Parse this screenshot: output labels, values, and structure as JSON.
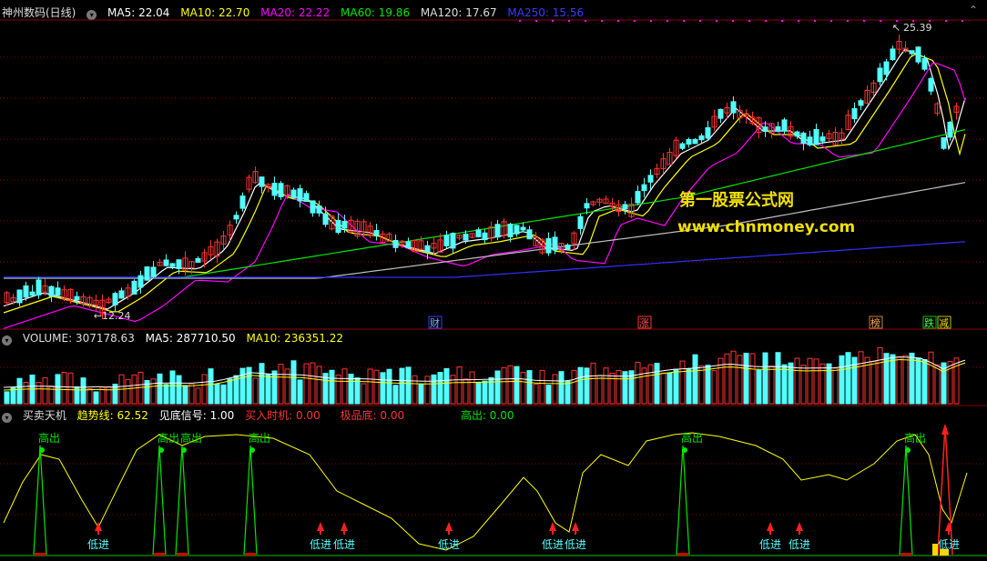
{
  "main_header": {
    "title": "神州数码(日线)",
    "ma5": "MA5: 22.04",
    "ma10": "MA10: 22.70",
    "ma20": "MA20: 22.22",
    "ma60": "MA60: 19.86",
    "ma120": "MA120: 17.67",
    "ma250": "MA250: 15.56"
  },
  "volume_header": {
    "title": "VOLUME: 307178.63",
    "ma5": "MA5: 287710.50",
    "ma10": "MA10: 236351.22"
  },
  "indicator_header": {
    "title": "买卖天机",
    "trend": "趋势线: 62.52",
    "bottom": "见底信号: 1.00",
    "buy": "买入时机: 0.00",
    "extreme": "极品底: 0.00",
    "high": "高出: 0.00"
  },
  "price_labels": {
    "high": "25.39",
    "low": "12.24"
  },
  "event_markers": [
    "财",
    "涨",
    "榜",
    "跌",
    "减"
  ],
  "signal_labels": {
    "high_out": "高出",
    "low_in": "低进"
  },
  "watermark": {
    "line1": "第一股票公式网",
    "line2": "www.chnmoney.com"
  },
  "colors": {
    "up": "#ff3232",
    "down": "#54ffff",
    "ma5": "#ffffff",
    "ma10": "#ffff00",
    "ma20": "#ff00ff",
    "ma60": "#00e600",
    "ma120": "#c0c0c0",
    "ma250": "#3030ff",
    "grid": "#8b0000"
  }
}
